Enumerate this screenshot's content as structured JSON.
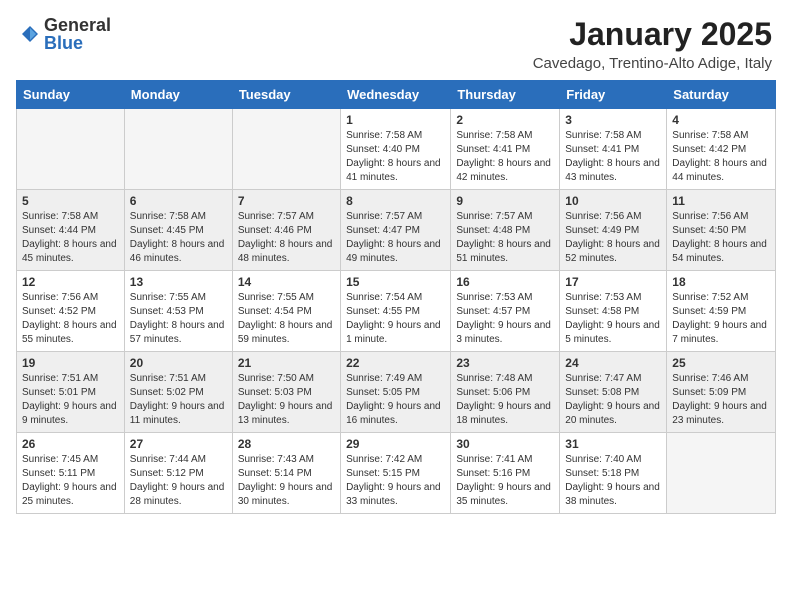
{
  "logo": {
    "general": "General",
    "blue": "Blue"
  },
  "title": "January 2025",
  "location": "Cavedago, Trentino-Alto Adige, Italy",
  "day_headers": [
    "Sunday",
    "Monday",
    "Tuesday",
    "Wednesday",
    "Thursday",
    "Friday",
    "Saturday"
  ],
  "weeks": [
    [
      {
        "num": "",
        "info": ""
      },
      {
        "num": "",
        "info": ""
      },
      {
        "num": "",
        "info": ""
      },
      {
        "num": "1",
        "info": "Sunrise: 7:58 AM\nSunset: 4:40 PM\nDaylight: 8 hours and 41 minutes."
      },
      {
        "num": "2",
        "info": "Sunrise: 7:58 AM\nSunset: 4:41 PM\nDaylight: 8 hours and 42 minutes."
      },
      {
        "num": "3",
        "info": "Sunrise: 7:58 AM\nSunset: 4:41 PM\nDaylight: 8 hours and 43 minutes."
      },
      {
        "num": "4",
        "info": "Sunrise: 7:58 AM\nSunset: 4:42 PM\nDaylight: 8 hours and 44 minutes."
      }
    ],
    [
      {
        "num": "5",
        "info": "Sunrise: 7:58 AM\nSunset: 4:44 PM\nDaylight: 8 hours and 45 minutes."
      },
      {
        "num": "6",
        "info": "Sunrise: 7:58 AM\nSunset: 4:45 PM\nDaylight: 8 hours and 46 minutes."
      },
      {
        "num": "7",
        "info": "Sunrise: 7:57 AM\nSunset: 4:46 PM\nDaylight: 8 hours and 48 minutes."
      },
      {
        "num": "8",
        "info": "Sunrise: 7:57 AM\nSunset: 4:47 PM\nDaylight: 8 hours and 49 minutes."
      },
      {
        "num": "9",
        "info": "Sunrise: 7:57 AM\nSunset: 4:48 PM\nDaylight: 8 hours and 51 minutes."
      },
      {
        "num": "10",
        "info": "Sunrise: 7:56 AM\nSunset: 4:49 PM\nDaylight: 8 hours and 52 minutes."
      },
      {
        "num": "11",
        "info": "Sunrise: 7:56 AM\nSunset: 4:50 PM\nDaylight: 8 hours and 54 minutes."
      }
    ],
    [
      {
        "num": "12",
        "info": "Sunrise: 7:56 AM\nSunset: 4:52 PM\nDaylight: 8 hours and 55 minutes."
      },
      {
        "num": "13",
        "info": "Sunrise: 7:55 AM\nSunset: 4:53 PM\nDaylight: 8 hours and 57 minutes."
      },
      {
        "num": "14",
        "info": "Sunrise: 7:55 AM\nSunset: 4:54 PM\nDaylight: 8 hours and 59 minutes."
      },
      {
        "num": "15",
        "info": "Sunrise: 7:54 AM\nSunset: 4:55 PM\nDaylight: 9 hours and 1 minute."
      },
      {
        "num": "16",
        "info": "Sunrise: 7:53 AM\nSunset: 4:57 PM\nDaylight: 9 hours and 3 minutes."
      },
      {
        "num": "17",
        "info": "Sunrise: 7:53 AM\nSunset: 4:58 PM\nDaylight: 9 hours and 5 minutes."
      },
      {
        "num": "18",
        "info": "Sunrise: 7:52 AM\nSunset: 4:59 PM\nDaylight: 9 hours and 7 minutes."
      }
    ],
    [
      {
        "num": "19",
        "info": "Sunrise: 7:51 AM\nSunset: 5:01 PM\nDaylight: 9 hours and 9 minutes."
      },
      {
        "num": "20",
        "info": "Sunrise: 7:51 AM\nSunset: 5:02 PM\nDaylight: 9 hours and 11 minutes."
      },
      {
        "num": "21",
        "info": "Sunrise: 7:50 AM\nSunset: 5:03 PM\nDaylight: 9 hours and 13 minutes."
      },
      {
        "num": "22",
        "info": "Sunrise: 7:49 AM\nSunset: 5:05 PM\nDaylight: 9 hours and 16 minutes."
      },
      {
        "num": "23",
        "info": "Sunrise: 7:48 AM\nSunset: 5:06 PM\nDaylight: 9 hours and 18 minutes."
      },
      {
        "num": "24",
        "info": "Sunrise: 7:47 AM\nSunset: 5:08 PM\nDaylight: 9 hours and 20 minutes."
      },
      {
        "num": "25",
        "info": "Sunrise: 7:46 AM\nSunset: 5:09 PM\nDaylight: 9 hours and 23 minutes."
      }
    ],
    [
      {
        "num": "26",
        "info": "Sunrise: 7:45 AM\nSunset: 5:11 PM\nDaylight: 9 hours and 25 minutes."
      },
      {
        "num": "27",
        "info": "Sunrise: 7:44 AM\nSunset: 5:12 PM\nDaylight: 9 hours and 28 minutes."
      },
      {
        "num": "28",
        "info": "Sunrise: 7:43 AM\nSunset: 5:14 PM\nDaylight: 9 hours and 30 minutes."
      },
      {
        "num": "29",
        "info": "Sunrise: 7:42 AM\nSunset: 5:15 PM\nDaylight: 9 hours and 33 minutes."
      },
      {
        "num": "30",
        "info": "Sunrise: 7:41 AM\nSunset: 5:16 PM\nDaylight: 9 hours and 35 minutes."
      },
      {
        "num": "31",
        "info": "Sunrise: 7:40 AM\nSunset: 5:18 PM\nDaylight: 9 hours and 38 minutes."
      },
      {
        "num": "",
        "info": ""
      }
    ]
  ]
}
